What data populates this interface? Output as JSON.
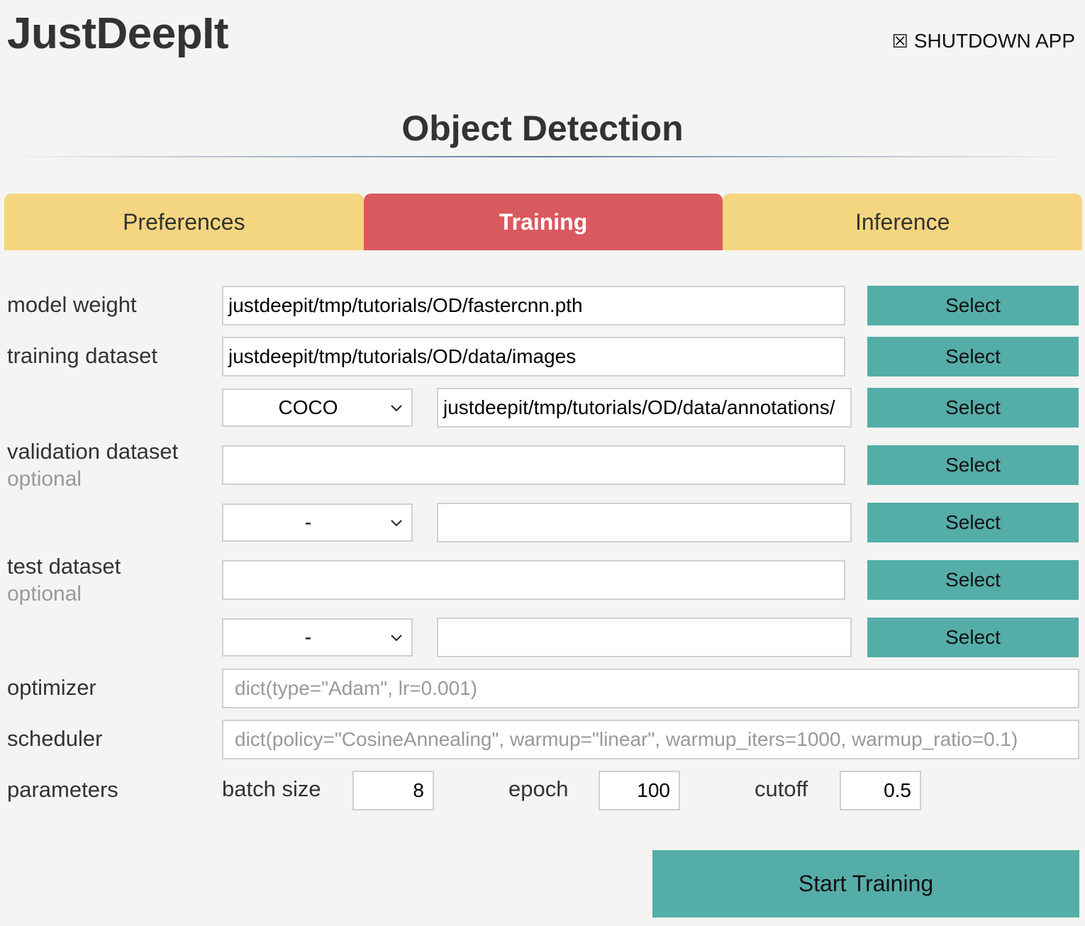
{
  "app": {
    "title": "JustDeepIt",
    "shutdown_label": "SHUTDOWN APP",
    "shutdown_icon": "☒"
  },
  "page": {
    "title": "Object Detection"
  },
  "tabs": [
    {
      "label": "Preferences",
      "active": false
    },
    {
      "label": "Training",
      "active": true
    },
    {
      "label": "Inference",
      "active": false
    }
  ],
  "form": {
    "model_weight": {
      "label": "model weight",
      "value": "justdeepit/tmp/tutorials/OD/fastercnn.pth",
      "button": "Select"
    },
    "training_dataset": {
      "label": "training dataset",
      "images_value": "justdeepit/tmp/tutorials/OD/data/images",
      "images_button": "Select",
      "format": "COCO",
      "annotations_value": "justdeepit/tmp/tutorials/OD/data/annotations/",
      "annotations_button": "Select"
    },
    "validation_dataset": {
      "label": "validation dataset",
      "sublabel": "optional",
      "images_value": "",
      "images_button": "Select",
      "format": "-",
      "annotations_value": "",
      "annotations_button": "Select"
    },
    "test_dataset": {
      "label": "test dataset",
      "sublabel": "optional",
      "images_value": "",
      "images_button": "Select",
      "format": "-",
      "annotations_value": "",
      "annotations_button": "Select"
    },
    "optimizer": {
      "label": "optimizer",
      "placeholder": "dict(type=\"Adam\", lr=0.001)"
    },
    "scheduler": {
      "label": "scheduler",
      "placeholder": "dict(policy=\"CosineAnnealing\", warmup=\"linear\", warmup_iters=1000, warmup_ratio=0.1)"
    },
    "parameters": {
      "label": "parameters",
      "batch_size_label": "batch size",
      "batch_size": "8",
      "epoch_label": "epoch",
      "epoch": "100",
      "cutoff_label": "cutoff",
      "cutoff": "0.5"
    }
  },
  "actions": {
    "start_label": "Start Training"
  }
}
